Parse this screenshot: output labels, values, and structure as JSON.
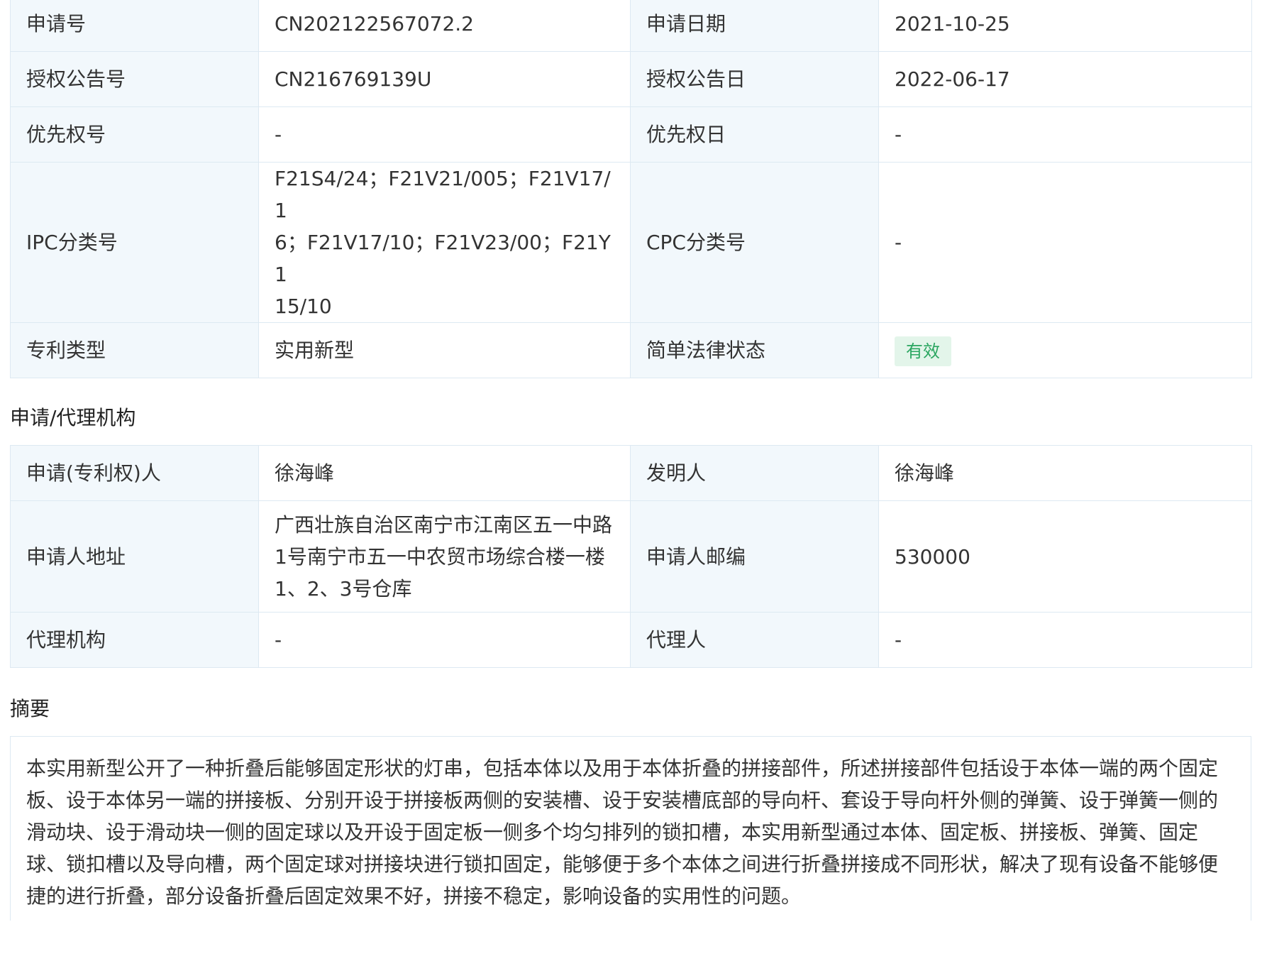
{
  "basic_info": {
    "rows": [
      {
        "l1": "申请号",
        "v1": "CN202122567072.2",
        "l2": "申请日期",
        "v2": "2021-10-25"
      },
      {
        "l1": "授权公告号",
        "v1": "CN216769139U",
        "l2": "授权公告日",
        "v2": "2022-06-17"
      },
      {
        "l1": "优先权号",
        "v1": "-",
        "l2": "优先权日",
        "v2": "-"
      },
      {
        "l1": "IPC分类号",
        "v1_lines": [
          "F21S4/24；F21V21/005；F21V17/1",
          "6；F21V17/10；F21V23/00；F21Y1",
          "15/10"
        ],
        "l2": "CPC分类号",
        "v2": "-"
      },
      {
        "l1": "专利类型",
        "v1": "实用新型",
        "l2": "简单法律状态",
        "v2_badge": "有效"
      }
    ]
  },
  "agency": {
    "title": "申请/代理机构",
    "rows": [
      {
        "l1": "申请(专利权)人",
        "v1": "徐海峰",
        "l2": "发明人",
        "v2": "徐海峰"
      },
      {
        "l1": "申请人地址",
        "v1_lines": [
          "广西壮族自治区南宁市江南区五一中路",
          "1号南宁市五一中农贸市场综合楼一楼",
          "1、2、3号仓库"
        ],
        "l2": "申请人邮编",
        "v2": "530000"
      },
      {
        "l1": "代理机构",
        "v1": "-",
        "l2": "代理人",
        "v2": "-"
      }
    ]
  },
  "abstract": {
    "title": "摘要",
    "lines": [
      "本实用新型公开了一种折叠后能够固定形状的灯串，包括本体以及用于本体折叠的拼接部件，所述拼接部件包括设于本体一端的两个固定",
      "板、设于本体另一端的拼接板、分别开设于拼接板两侧的安装槽、设于安装槽底部的导向杆、套设于导向杆外侧的弹簧、设于弹簧一侧的",
      "滑动块、设于滑动块一侧的固定球以及开设于固定板一侧多个均匀排列的锁扣槽，本实用新型通过本体、固定板、拼接板、弹簧、固定",
      "球、锁扣槽以及导向槽，两个固定球对拼接块进行锁扣固定，能够便于多个本体之间进行折叠拼接成不同形状，解决了现有设备不能够便",
      "捷的进行折叠，部分设备折叠后固定效果不好，拼接不稳定，影响设备的实用性的问题。"
    ]
  },
  "colors": {
    "label_bg": "#f2f8fc",
    "border": "#dde9f2",
    "badge_bg": "#e3f5ea",
    "badge_text": "#2aa660"
  }
}
